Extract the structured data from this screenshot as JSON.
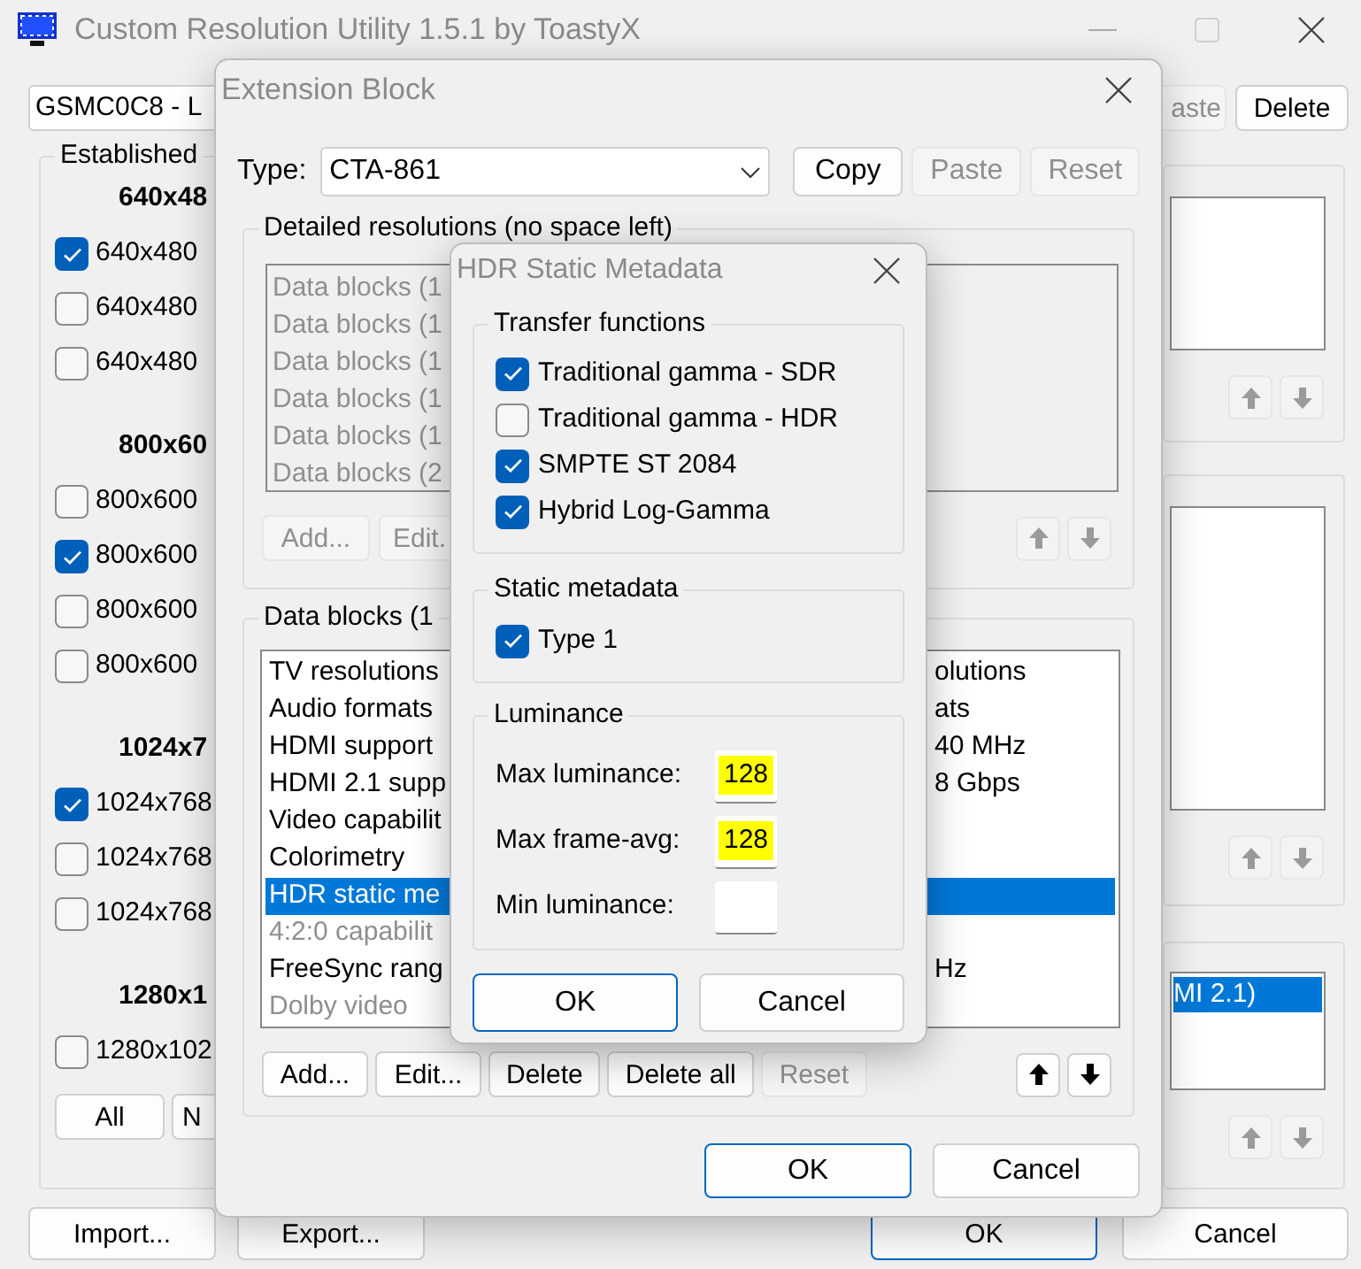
{
  "window": {
    "title": "Custom Resolution Utility 1.5.1 by ToastyX"
  },
  "main": {
    "display": "GSMC0C8 - L",
    "top_buttons": [
      {
        "label": "aste",
        "disabled": true
      },
      {
        "label": "Delete",
        "disabled": false
      }
    ],
    "established": {
      "title": "Established",
      "groups": [
        {
          "header": "640x48",
          "items": [
            {
              "label": "640x480",
              "checked": true
            },
            {
              "label": "640x480",
              "checked": false
            },
            {
              "label": "640x480",
              "checked": false
            }
          ]
        },
        {
          "header": "800x60",
          "items": [
            {
              "label": "800x600",
              "checked": false
            },
            {
              "label": "800x600",
              "checked": true
            },
            {
              "label": "800x600",
              "checked": false
            },
            {
              "label": "800x600",
              "checked": false
            }
          ]
        },
        {
          "header": "1024x7",
          "items": [
            {
              "label": "1024x768",
              "checked": true
            },
            {
              "label": "1024x768",
              "checked": false
            },
            {
              "label": "1024x768",
              "checked": false
            }
          ]
        },
        {
          "header": "1280x1",
          "items": [
            {
              "label": "1280x102",
              "checked": false
            }
          ]
        }
      ],
      "buttons": [
        "All",
        "N"
      ]
    },
    "right_list_rows": [
      {
        "text": "MI 2.1)",
        "selected": true
      }
    ],
    "right_arrows_disabled": true,
    "left_buttons": [
      "Import...",
      "Export..."
    ],
    "right_buttons": [
      {
        "label": "OK",
        "default": true
      },
      {
        "label": "Cancel",
        "default": false
      }
    ]
  },
  "extension_block": {
    "title": "Extension Block",
    "type_label": "Type:",
    "type_value": "CTA-861",
    "buttons": [
      {
        "label": "Copy",
        "disabled": false
      },
      {
        "label": "Paste",
        "disabled": true
      },
      {
        "label": "Reset",
        "disabled": true
      }
    ],
    "detailed": {
      "title": "Detailed resolutions (no space left)",
      "disabled": true,
      "items": [
        "Data blocks (1",
        "Data blocks (1",
        "Data blocks (1",
        "Data blocks (1",
        "Data blocks (1",
        "Data blocks (2"
      ],
      "buttons": [
        {
          "label": "Add...",
          "disabled": true
        },
        {
          "label": "Edit.",
          "disabled": true
        }
      ],
      "arrows_disabled": true
    },
    "data_blocks": {
      "title": "Data blocks (1",
      "items": [
        {
          "label": "TV resolutions",
          "detail": "olutions",
          "selected": false,
          "disabled": false
        },
        {
          "label": "Audio formats",
          "detail": "ats",
          "selected": false,
          "disabled": false
        },
        {
          "label": "HDMI support",
          "detail": "40 MHz",
          "selected": false,
          "disabled": false
        },
        {
          "label": "HDMI 2.1 supp",
          "detail": "8 Gbps",
          "selected": false,
          "disabled": false
        },
        {
          "label": "Video capabilit",
          "selected": false,
          "disabled": false
        },
        {
          "label": "Colorimetry",
          "selected": false,
          "disabled": false
        },
        {
          "label": "HDR static me",
          "selected": true,
          "disabled": false
        },
        {
          "label": "4:2:0 capabilit",
          "selected": false,
          "disabled": true
        },
        {
          "label": "FreeSync rang",
          "detail": "Hz",
          "selected": false,
          "disabled": false
        },
        {
          "label": "Dolby video",
          "selected": false,
          "disabled": true
        }
      ],
      "buttons": [
        {
          "label": "Add...",
          "disabled": false
        },
        {
          "label": "Edit...",
          "disabled": false
        },
        {
          "label": "Delete",
          "disabled": false
        },
        {
          "label": "Delete all",
          "disabled": false
        },
        {
          "label": "Reset",
          "disabled": true
        }
      ],
      "arrows_disabled": false
    },
    "footer_buttons": [
      {
        "label": "OK",
        "default": true
      },
      {
        "label": "Cancel",
        "default": false
      }
    ]
  },
  "hdr_dialog": {
    "title": "HDR Static Metadata",
    "transfer": {
      "title": "Transfer functions",
      "items": [
        {
          "label": "Traditional gamma - SDR",
          "checked": true
        },
        {
          "label": "Traditional gamma - HDR",
          "checked": false
        },
        {
          "label": "SMPTE ST 2084",
          "checked": true
        },
        {
          "label": "Hybrid Log-Gamma",
          "checked": true
        }
      ]
    },
    "static": {
      "title": "Static metadata",
      "items": [
        {
          "label": "Type 1",
          "checked": true
        }
      ]
    },
    "luminance": {
      "title": "Luminance",
      "fields": [
        {
          "label": "Max luminance:",
          "value": "128",
          "highlighted": true
        },
        {
          "label": "Max frame-avg:",
          "value": "128",
          "highlighted": true
        },
        {
          "label": "Min luminance:"
        }
      ]
    },
    "buttons": [
      {
        "label": "OK",
        "default": true
      },
      {
        "label": "Cancel",
        "default": false
      }
    ]
  }
}
